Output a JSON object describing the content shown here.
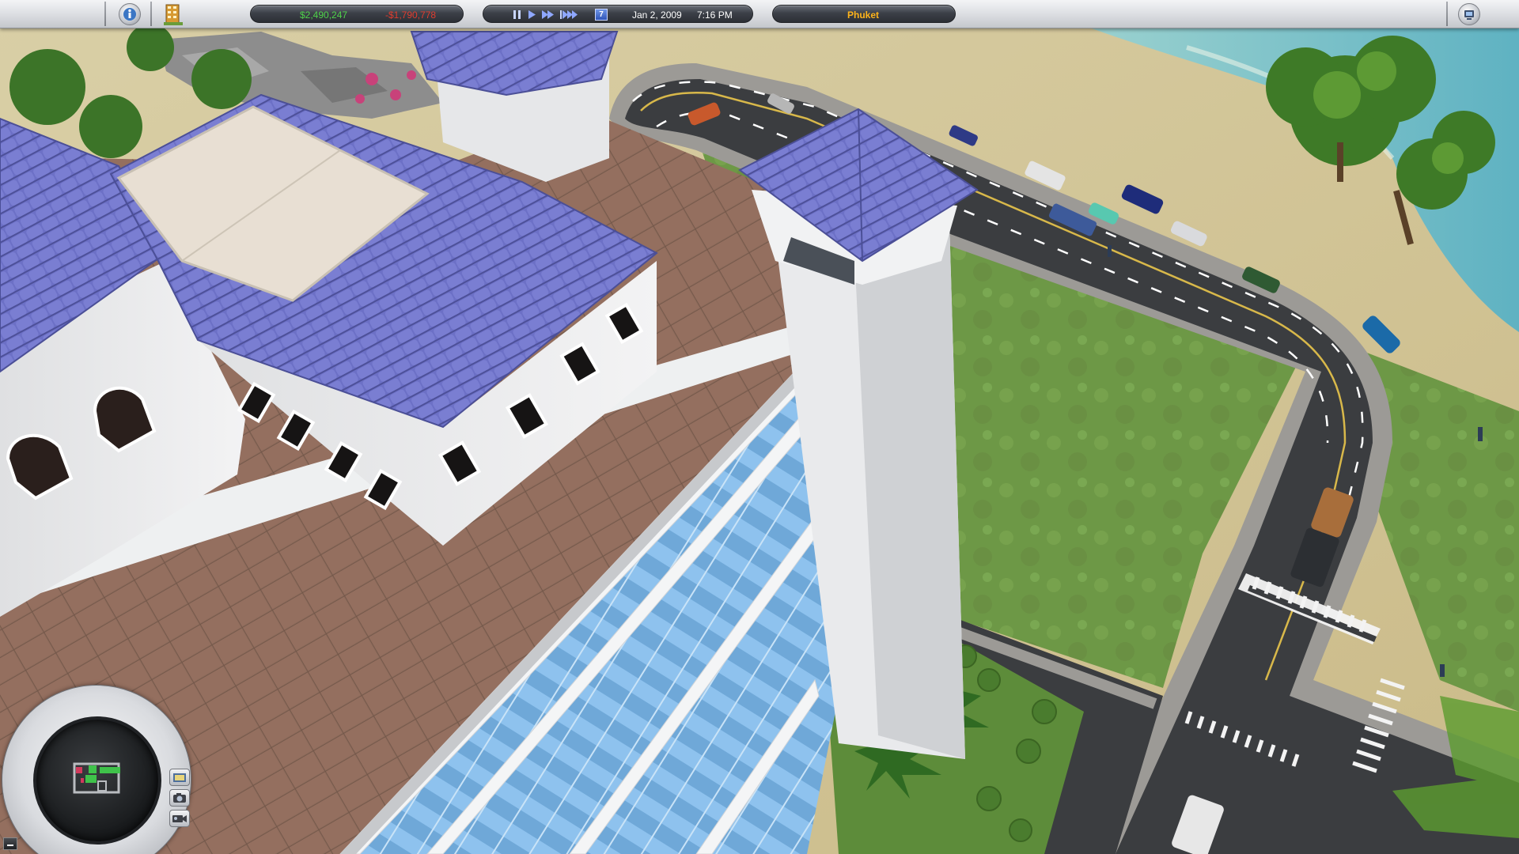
{
  "topbar": {
    "money": "$2,490,247",
    "loss": "-$1,790,778",
    "date": "Jan 2, 2009",
    "time": "7:16 PM",
    "speed_day_label": "7",
    "location": "Phuket"
  },
  "icons": {
    "info": "info-icon",
    "build": "build-hotel-icon",
    "pause": "pause-icon",
    "play": "play-icon",
    "fast": "fast-forward-icon",
    "faster": "fastest-forward-icon",
    "calendar": "calendar-icon",
    "system": "system-menu-icon",
    "overview": "overview-camera-icon",
    "screenshot": "screenshot-camera-icon",
    "video": "video-camera-icon",
    "minimize": "minimize-icon"
  },
  "colors": {
    "money": "#4fd14a",
    "loss": "#e03c2e",
    "location": "#ffb41a",
    "roof_tiles": "#6b6fc4",
    "grass": "#6f9a48",
    "road": "#3a3c3f",
    "sand": "#d2c497",
    "sea": "#7fc3c7"
  }
}
